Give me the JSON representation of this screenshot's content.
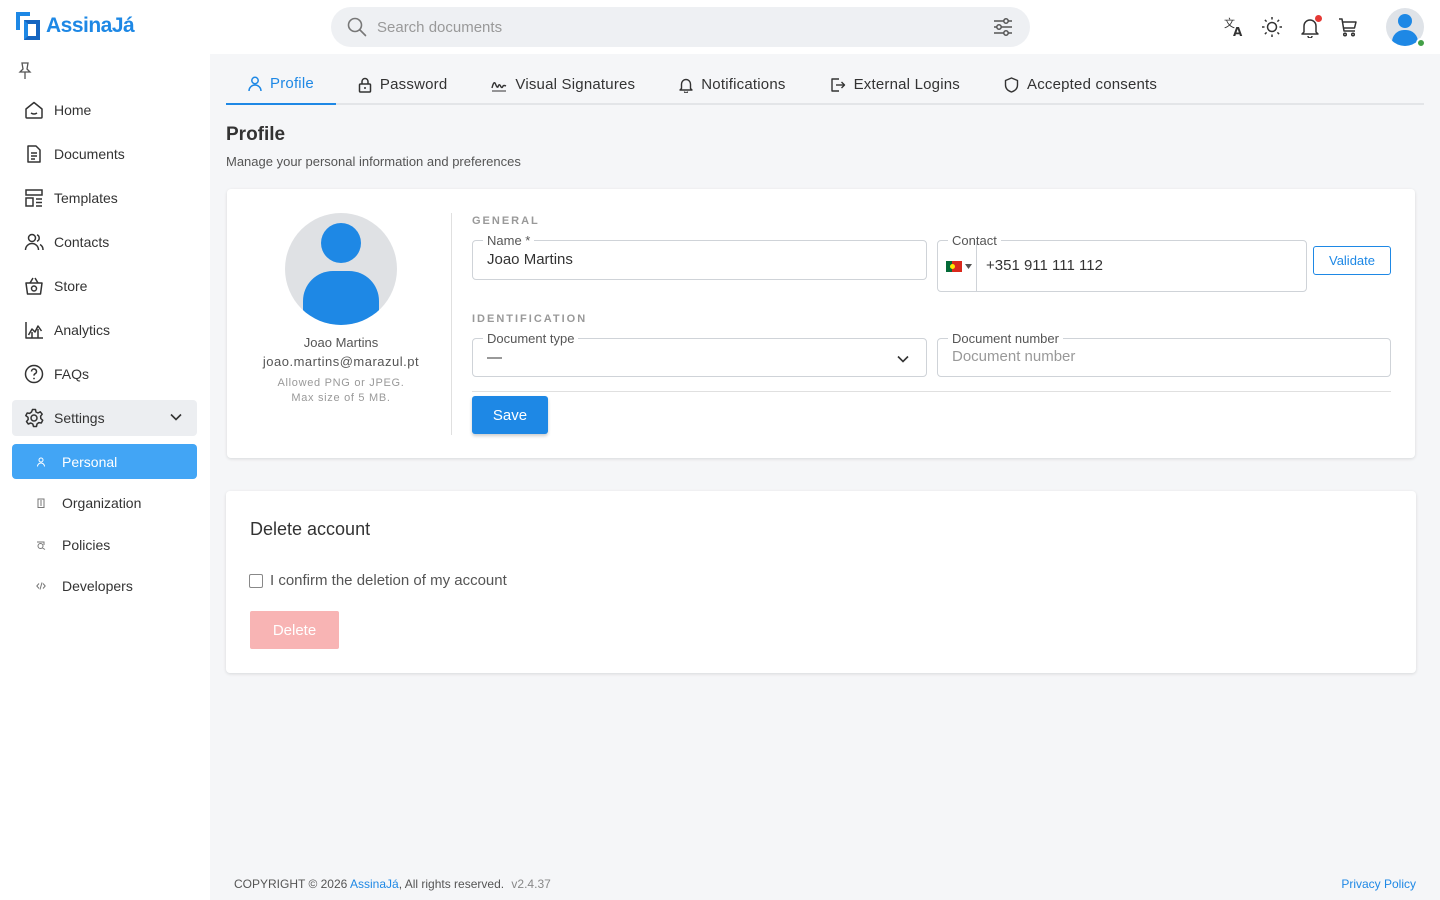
{
  "app": {
    "name": "AssinaJá",
    "accent": "#1e88e5"
  },
  "search": {
    "placeholder": "Search documents"
  },
  "sidebar": {
    "items": [
      {
        "label": "Home",
        "icon": "home-icon"
      },
      {
        "label": "Documents",
        "icon": "document-icon"
      },
      {
        "label": "Templates",
        "icon": "templates-icon"
      },
      {
        "label": "Contacts",
        "icon": "contacts-icon"
      },
      {
        "label": "Store",
        "icon": "store-icon"
      },
      {
        "label": "Analytics",
        "icon": "analytics-icon"
      },
      {
        "label": "FAQs",
        "icon": "help-icon"
      }
    ],
    "settings": {
      "label": "Settings",
      "children": [
        {
          "label": "Personal",
          "active": true
        },
        {
          "label": "Organization"
        },
        {
          "label": "Policies"
        },
        {
          "label": "Developers"
        }
      ]
    }
  },
  "tabs": [
    {
      "label": "Profile",
      "active": true,
      "icon": "user-icon"
    },
    {
      "label": "Password",
      "icon": "lock-icon"
    },
    {
      "label": "Visual Signatures",
      "icon": "signature-icon"
    },
    {
      "label": "Notifications",
      "icon": "bell-icon"
    },
    {
      "label": "External Logins",
      "icon": "login-icon"
    },
    {
      "label": "Accepted consents",
      "icon": "shield-icon"
    }
  ],
  "page": {
    "title": "Profile",
    "subtitle": "Manage your personal information and preferences"
  },
  "profile": {
    "name": "Joao Martins",
    "email": "joao.martins@marazul.pt",
    "note_line1": "Allowed PNG or JPEG.",
    "note_line2": "Max size of 5 MB.",
    "general_label": "GENERAL",
    "name_field_label": "Name *",
    "name_value": "Joao Martins",
    "contact_label": "Contact",
    "contact_value": "+351 911 111 112",
    "validate_label": "Validate",
    "identification_label": "IDENTIFICATION",
    "doc_type_label": "Document type",
    "doc_type_value": "—",
    "doc_number_label": "Document number",
    "doc_number_placeholder": "Document number",
    "save_label": "Save"
  },
  "delete_account": {
    "title": "Delete account",
    "confirm_label": "I confirm the deletion of my account",
    "delete_label": "Delete"
  },
  "footer": {
    "copyright": "COPYRIGHT © 2026",
    "brand": "AssinaJá",
    "rights": ", All rights reserved.",
    "version": "v2.4.37",
    "privacy": "Privacy Policy"
  }
}
